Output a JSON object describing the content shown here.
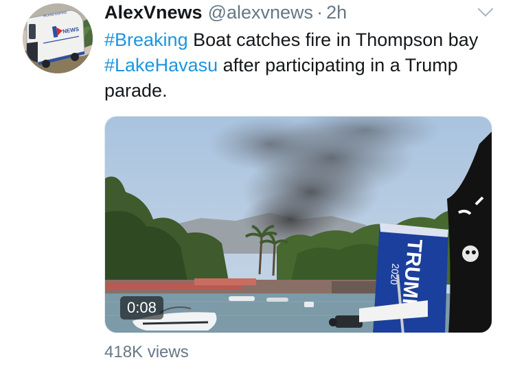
{
  "tweet": {
    "display_name": "AlexVnews",
    "handle": "@alexvnews",
    "separator": "·",
    "time": "2h",
    "text_parts": [
      {
        "type": "hashtag",
        "text": "#Breaking"
      },
      {
        "type": "text",
        "text": " Boat catches fire in Thompson bay "
      },
      {
        "type": "hashtag",
        "text": "#LakeHavasu"
      },
      {
        "type": "text",
        "text": " after participating in a Trump parade."
      }
    ],
    "hashtag_color": "#1b95e0"
  },
  "avatar": {
    "icon": "news-van-avatar",
    "sign_text": "INLAND EMPIRE",
    "logo_text": "NEWS"
  },
  "media": {
    "type": "video",
    "duration": "0:08",
    "flag_text": "TRUMP",
    "flag_subtext": "2020"
  },
  "stats": {
    "views": "418K views"
  },
  "icons": {
    "menu": "chevron-down-icon"
  }
}
